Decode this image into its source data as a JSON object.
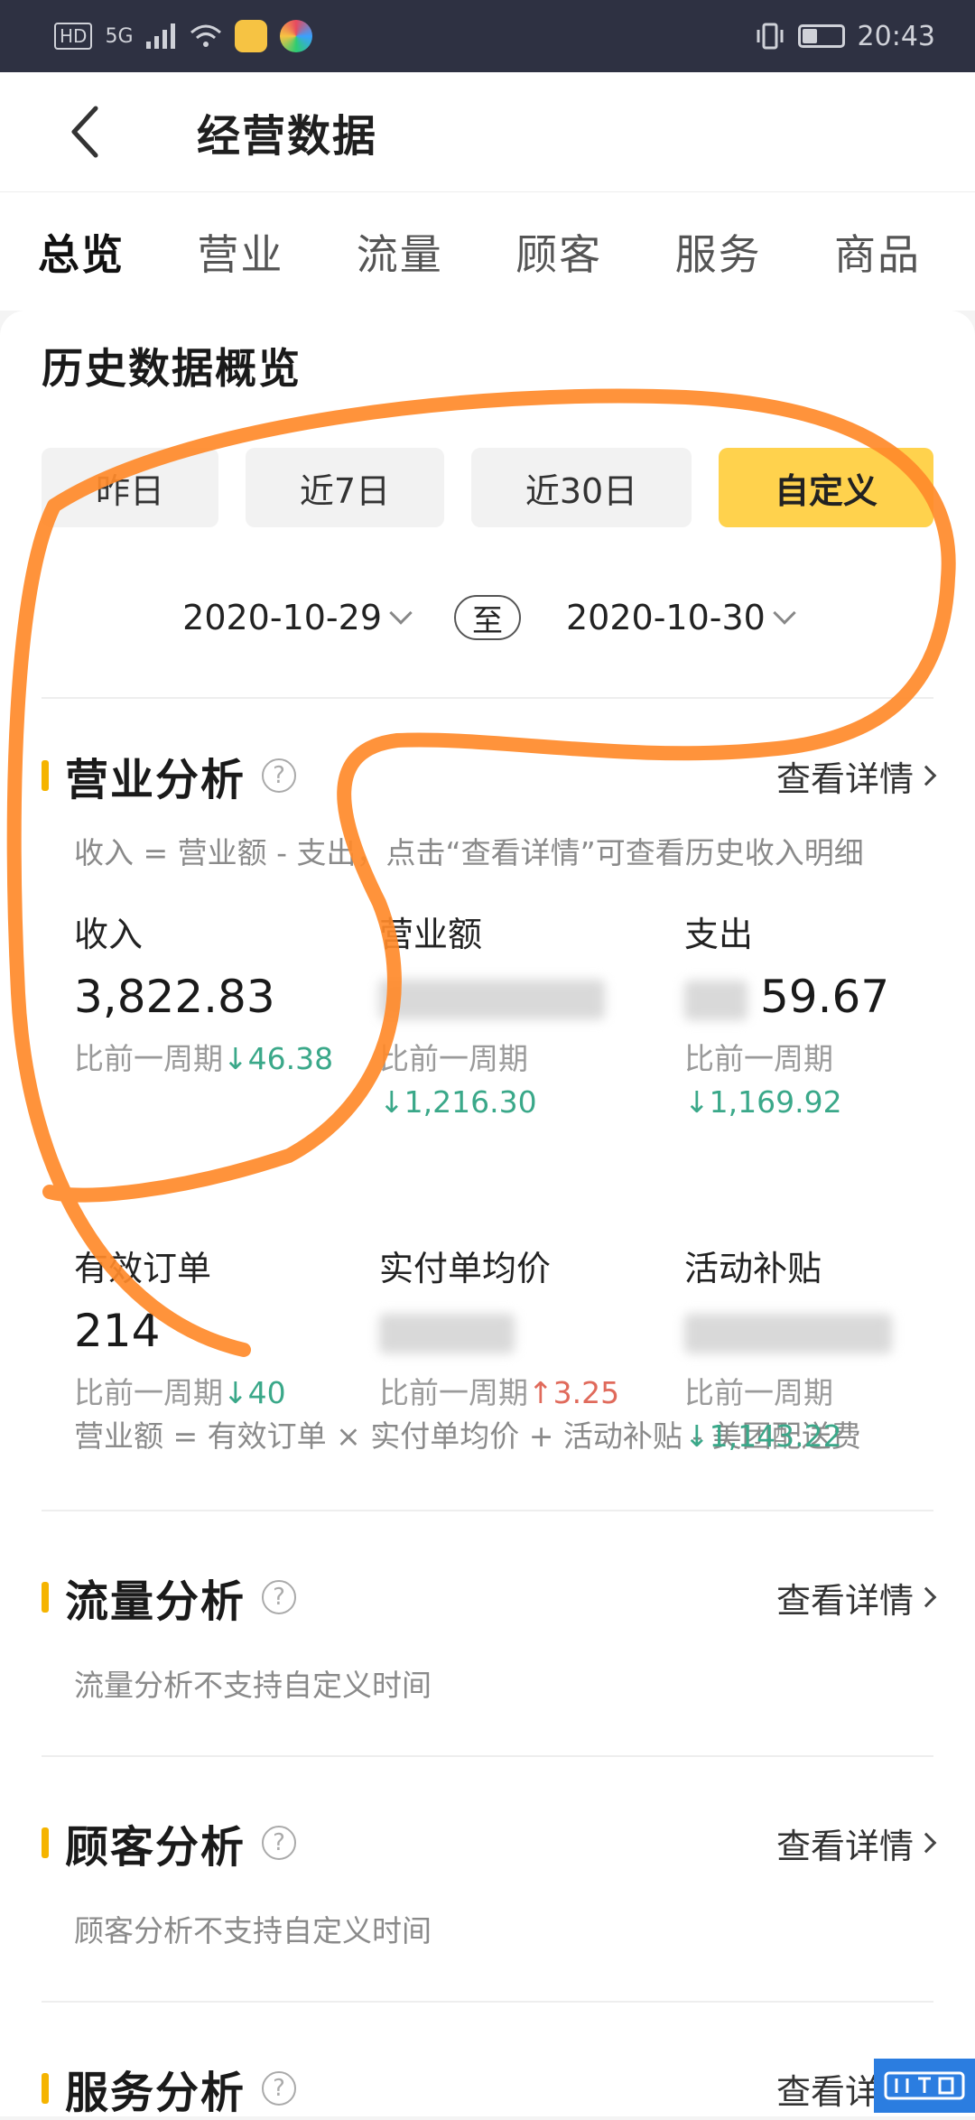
{
  "status_bar": {
    "net_badge": "HD",
    "signal": "5G",
    "time": "20:43"
  },
  "header": {
    "title": "经营数据"
  },
  "tabs": [
    {
      "label": "总览",
      "active": true
    },
    {
      "label": "营业",
      "active": false
    },
    {
      "label": "流量",
      "active": false
    },
    {
      "label": "顾客",
      "active": false
    },
    {
      "label": "服务",
      "active": false
    },
    {
      "label": "商品",
      "active": false
    }
  ],
  "history": {
    "title": "历史数据概览",
    "ranges": [
      "昨日",
      "近7日",
      "近30日",
      "自定义"
    ],
    "start_date": "2020-10-29",
    "to_label": "至",
    "end_date": "2020-10-30"
  },
  "business": {
    "title": "营业分析",
    "detail": "查看详情",
    "note1": "收入 = 营业额 - 支出，点击“查看详情”可查看历史收入明细",
    "note2": "营业额 = 有效订单 × 实付单均价 + 活动补贴 - 美团配送费",
    "compare_label": "比前一周期",
    "metrics_row1": [
      {
        "label": "收入",
        "value": "3,822.83",
        "change": "46.38",
        "dir": "down"
      },
      {
        "label": "营业额",
        "value": "",
        "change": "1,216.30",
        "dir": "down"
      },
      {
        "label": "支出",
        "value": "59.67",
        "change": "1,169.92",
        "dir": "down"
      }
    ],
    "metrics_row2": [
      {
        "label": "有效订单",
        "value": "214",
        "change": "40",
        "dir": "down"
      },
      {
        "label": "实付单均价",
        "value": "",
        "change": "3.25",
        "dir": "up"
      },
      {
        "label": "活动补贴",
        "value": "",
        "change": "1,143.22",
        "dir": "down"
      }
    ]
  },
  "traffic": {
    "title": "流量分析",
    "detail": "查看详情",
    "note": "流量分析不支持自定义时间"
  },
  "customer": {
    "title": "顾客分析",
    "detail": "查看详情",
    "note": "顾客分析不支持自定义时间"
  },
  "service": {
    "title": "服务分析",
    "detail": "查看详情"
  },
  "arrows": {
    "down": "↓",
    "up": "↑"
  },
  "help_mark": "?",
  "colors": {
    "accent": "#ffd24d",
    "down": "#3aa889",
    "up": "#e06a5b",
    "section_bar": "#f5b400",
    "annotation": "#ff8a2a"
  }
}
